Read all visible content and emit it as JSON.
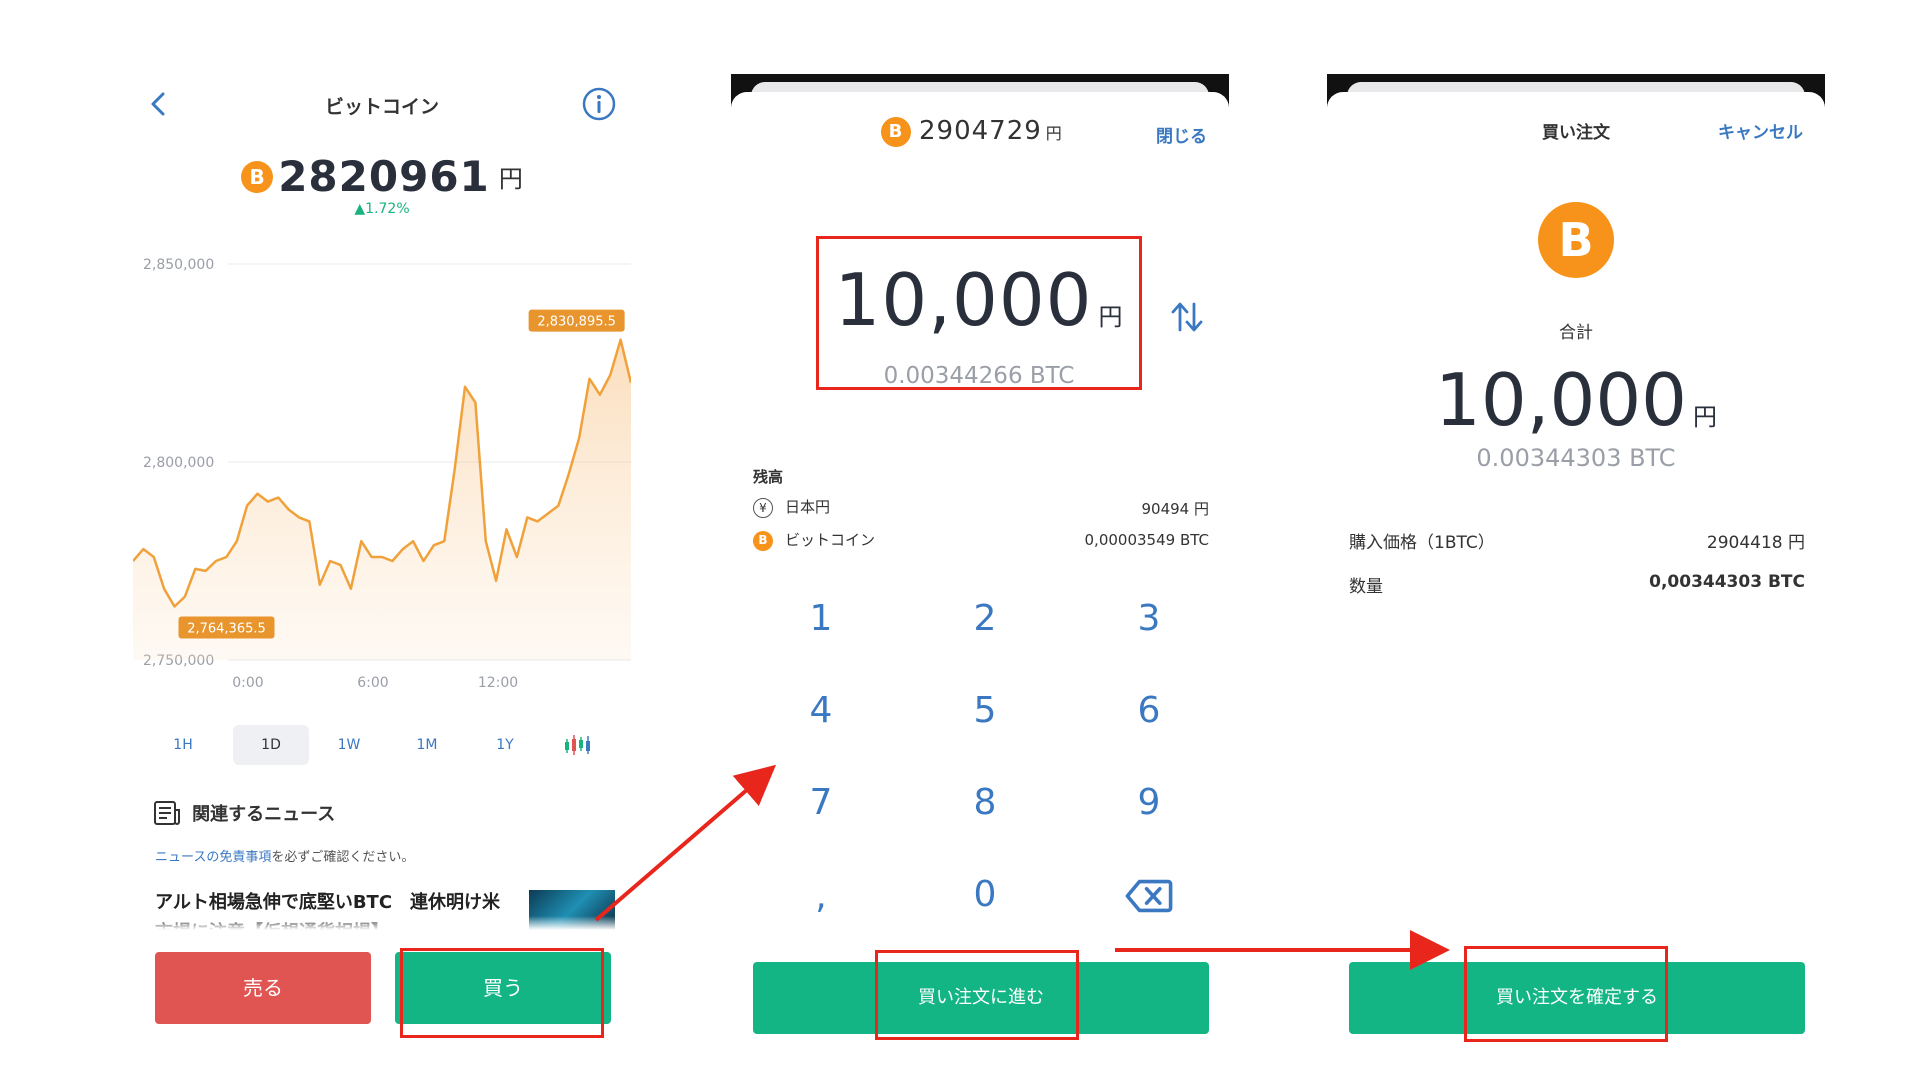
{
  "panel1": {
    "title": "ビットコイン",
    "price": "2820961",
    "unit": "円",
    "change": "▲1.72%",
    "coin_symbol": "B",
    "timeframes": [
      "1H",
      "1D",
      "1W",
      "1M",
      "1Y"
    ],
    "active_timeframe": "1D",
    "news_title": "関連するニュース",
    "news_note_link": "ニュースの免責事項",
    "news_note_rest": "を必ずご確認ください。",
    "news_item": "アルト相場急伸で底堅いBTC　連休明け米市場に注意【仮想通貨相場】",
    "sell_label": "売る",
    "buy_label": "買う"
  },
  "chart_data": {
    "type": "area",
    "x": [
      "0:00",
      "6:00",
      "12:00"
    ],
    "yticks": [
      "2,850,000",
      "2,800,000",
      "2,750,000"
    ],
    "ylim": [
      2750000,
      2850000
    ],
    "high_label": "2,830,895.5",
    "low_label": "2,764,365.5",
    "values": [
      2775000,
      2778000,
      2776000,
      2768000,
      2763500,
      2766000,
      2773000,
      2772500,
      2775000,
      2776000,
      2780000,
      2789000,
      2792000,
      2790000,
      2791000,
      2788000,
      2786000,
      2785000,
      2769000,
      2775000,
      2774000,
      2768000,
      2780000,
      2776000,
      2776000,
      2775000,
      2778000,
      2780000,
      2775000,
      2779000,
      2780000,
      2798000,
      2819000,
      2815000,
      2780000,
      2770000,
      2783000,
      2776000,
      2786000,
      2785000,
      2787000,
      2789000,
      2797000,
      2806000,
      2821000,
      2817000,
      2822000,
      2830895,
      2820000
    ],
    "color": "#f0a13a"
  },
  "panel2": {
    "price": "2904729",
    "unit": "円",
    "close_label": "閉じる",
    "amount": "10,000",
    "amount_btc": "0.00344266 BTC",
    "balance_label": "残高",
    "balances": [
      {
        "name": "日本円",
        "value": "90494 円"
      },
      {
        "name": "ビットコイン",
        "value": "0,00003549 BTC"
      }
    ],
    "keys": [
      "1",
      "2",
      "3",
      "4",
      "5",
      "6",
      "7",
      "8",
      "9",
      ",",
      "0"
    ],
    "confirm_label": "買い注文に進む"
  },
  "panel3": {
    "title": "買い注文",
    "cancel_label": "キャンセル",
    "total_label": "合計",
    "total_amount": "10,000",
    "unit": "円",
    "total_btc": "0.00344303 BTC",
    "rows": [
      {
        "label": "購入価格（1BTC）",
        "value": "2904418 円"
      },
      {
        "label": "数量",
        "value": "0,00344303 BTC"
      }
    ],
    "order_label": "買い注文を確定する"
  },
  "colors": {
    "accent_green": "#13b584",
    "sell_red": "#e05452",
    "link_blue": "#3b78c2",
    "btc_orange": "#f7931a",
    "highlight_red": "#e8261b"
  }
}
